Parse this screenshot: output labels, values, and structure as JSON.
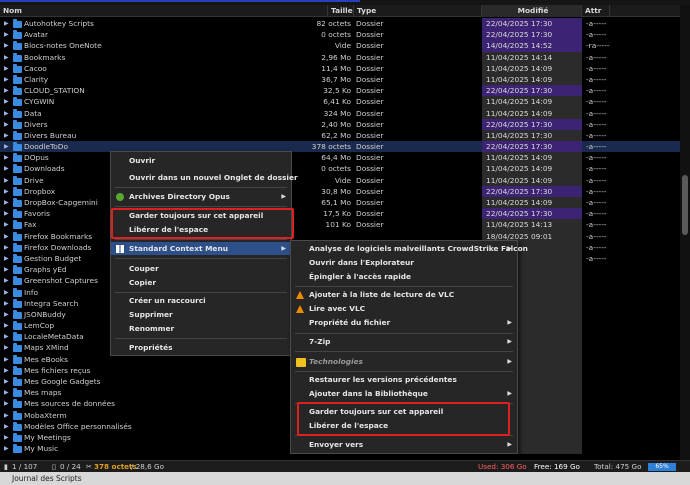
{
  "header": {
    "name": "Nom",
    "size": "Taille",
    "type": "Type",
    "modified": "Modifié",
    "attr": "Attr"
  },
  "rows": [
    {
      "name": "Autohotkey Scripts",
      "size": "82 octets",
      "type": "Dossier",
      "modified": "22/04/2025 17:30",
      "attr": "-a-----",
      "recent": true
    },
    {
      "name": "Avatar",
      "size": "0 octets",
      "type": "Dossier",
      "modified": "22/04/2025 17:30",
      "attr": "-a-----",
      "recent": true
    },
    {
      "name": "Blocs-notes OneNote",
      "size": "Vide",
      "type": "Dossier",
      "modified": "14/04/2025 14:52",
      "attr": "-ra-----",
      "recent": true
    },
    {
      "name": "Bookmarks",
      "size": "2,96 Mo",
      "type": "Dossier",
      "modified": "11/04/2025 14:14",
      "attr": "-a-----",
      "recent": false
    },
    {
      "name": "Cacoo",
      "size": "11,4 Mo",
      "type": "Dossier",
      "modified": "11/04/2025 14:09",
      "attr": "-a-----",
      "recent": false
    },
    {
      "name": "Clarity",
      "size": "36,7 Mo",
      "type": "Dossier",
      "modified": "11/04/2025 14:09",
      "attr": "-a-----",
      "recent": false
    },
    {
      "name": "CLOUD_STATION",
      "size": "32,5 Ko",
      "type": "Dossier",
      "modified": "22/04/2025 17:30",
      "attr": "-a-----",
      "recent": true
    },
    {
      "name": "CYGWIN",
      "size": "6,41 Ko",
      "type": "Dossier",
      "modified": "11/04/2025 14:09",
      "attr": "-a-----",
      "recent": false
    },
    {
      "name": "Data",
      "size": "324 Mo",
      "type": "Dossier",
      "modified": "11/04/2025 14:09",
      "attr": "-a-----",
      "recent": false
    },
    {
      "name": "Divers",
      "size": "2,40 Mo",
      "type": "Dossier",
      "modified": "22/04/2025 17:30",
      "attr": "-a-----",
      "recent": true
    },
    {
      "name": "Divers Bureau",
      "size": "62,2 Mo",
      "type": "Dossier",
      "modified": "11/04/2025 17:30",
      "attr": "-a-----",
      "recent": false
    },
    {
      "name": "DoodleToDo",
      "size": "378 octets",
      "type": "Dossier",
      "modified": "22/04/2025 17:30",
      "attr": "-a-----",
      "recent": true,
      "selected": true
    },
    {
      "name": "DOpus",
      "size": "64,4 Mo",
      "type": "Dossier",
      "modified": "11/04/2025 14:09",
      "attr": "-a-----",
      "recent": false
    },
    {
      "name": "Downloads",
      "size": "0 octets",
      "type": "Dossier",
      "modified": "11/04/2025 14:09",
      "attr": "-a-----",
      "recent": false
    },
    {
      "name": "Drive",
      "size": "Vide",
      "type": "Dossier",
      "modified": "11/04/2025 14:09",
      "attr": "-a-----",
      "recent": false
    },
    {
      "name": "Dropbox",
      "size": "30,8 Mo",
      "type": "Dossier",
      "modified": "22/04/2025 17:30",
      "attr": "-a-----",
      "recent": true
    },
    {
      "name": "DropBox-Capgemini",
      "size": "65,1 Mo",
      "type": "Dossier",
      "modified": "11/04/2025 14:09",
      "attr": "-a-----",
      "recent": false
    },
    {
      "name": "Favoris",
      "size": "17,5 Ko",
      "type": "Dossier",
      "modified": "22/04/2025 17:30",
      "attr": "-a-----",
      "recent": true
    },
    {
      "name": "Fax",
      "size": "101 Ko",
      "type": "Dossier",
      "modified": "11/04/2025 14:13",
      "attr": "-a-----",
      "recent": false
    },
    {
      "name": "Firefox Bookmarks",
      "size": "",
      "type": "",
      "modified": "18/04/2025 09:01",
      "attr": "-a-----",
      "recent": false
    },
    {
      "name": "Firefox Downloads",
      "size": "",
      "type": "",
      "modified": "",
      "attr": "-a-----",
      "recent": true
    },
    {
      "name": "Gestion Budget",
      "size": "",
      "type": "",
      "modified": "",
      "attr": "-a-----",
      "recent": true
    },
    {
      "name": "Graphs yEd",
      "size": "",
      "type": "",
      "modified": "",
      "attr": "",
      "recent": false
    },
    {
      "name": "Greenshot Captures",
      "size": "",
      "type": "",
      "modified": "",
      "attr": "",
      "recent": false
    },
    {
      "name": "Info",
      "size": "",
      "type": "",
      "modified": "",
      "attr": "",
      "recent": false
    },
    {
      "name": "Integra Search",
      "size": "",
      "type": "",
      "modified": "",
      "attr": "",
      "recent": false
    },
    {
      "name": "JSONBuddy",
      "size": "",
      "type": "",
      "modified": "",
      "attr": "",
      "recent": false
    },
    {
      "name": "LemCop",
      "size": "",
      "type": "",
      "modified": "",
      "attr": "",
      "recent": false
    },
    {
      "name": "LocaleMetaData",
      "size": "",
      "type": "",
      "modified": "",
      "attr": "",
      "recent": false
    },
    {
      "name": "Maps XMind",
      "size": "",
      "type": "",
      "modified": "",
      "attr": "",
      "recent": false
    },
    {
      "name": "Mes eBooks",
      "size": "",
      "type": "",
      "modified": "",
      "attr": "",
      "recent": false
    },
    {
      "name": "Mes fichiers reçus",
      "size": "",
      "type": "",
      "modified": "",
      "attr": "",
      "recent": false
    },
    {
      "name": "Mes Google Gadgets",
      "size": "",
      "type": "",
      "modified": "",
      "attr": "",
      "recent": false
    },
    {
      "name": "Mes maps",
      "size": "",
      "type": "",
      "modified": "",
      "attr": "",
      "recent": false
    },
    {
      "name": "Mes sources de données",
      "size": "",
      "type": "",
      "modified": "",
      "attr": "",
      "recent": false
    },
    {
      "name": "MobaXterm",
      "size": "",
      "type": "",
      "modified": "",
      "attr": "",
      "recent": false
    },
    {
      "name": "Modèles Office personnalisés",
      "size": "",
      "type": "",
      "modified": "",
      "attr": "",
      "recent": false
    },
    {
      "name": "My Meetings",
      "size": "",
      "type": "",
      "modified": "",
      "attr": "",
      "recent": false
    },
    {
      "name": "My Music",
      "size": "",
      "type": "",
      "modified": "",
      "attr": "",
      "recent": false
    }
  ],
  "context_menu": {
    "open": "Ouvrir",
    "open_new_tab": "Ouvrir dans un nouvel Onglet de dossier",
    "archives": "Archives Directory Opus",
    "keep_on_device": "Garder toujours sur cet appareil",
    "free_space": "Libérer de l'espace",
    "standard_menu": "Standard Context Menu",
    "cut": "Couper",
    "copy": "Copier",
    "create_shortcut": "Créer un raccourci",
    "delete": "Supprimer",
    "rename": "Renommer",
    "properties": "Propriétés"
  },
  "submenu": {
    "crowdstrike": "Analyse de logiciels malveillants CrowdStrike Falcon",
    "open_explorer": "Ouvrir dans l'Explorateur",
    "pin_quick_access": "Épingler à l'accès rapide",
    "vlc_add": "Ajouter à la liste de lecture de VLC",
    "vlc_play": "Lire avec VLC",
    "ownership": "Propriété du fichier",
    "sevenzip": "7-Zip",
    "technologies": "Technologies",
    "restore_versions": "Restaurer les versions précédentes",
    "add_library": "Ajouter dans la Bibliothèque",
    "keep_on_device": "Garder toujours sur cet appareil",
    "free_space": "Libérer de l'espace",
    "send_to": "Envoyer vers"
  },
  "status": {
    "count": "1 / 107",
    "files": "0 / 24",
    "selection": "378 octets",
    "total": "/ 28,6 Go",
    "used": "Used: 306 Go",
    "free": "Free: 169 Go",
    "total_disk": "Total: 475 Go",
    "pct": "65%"
  },
  "bottom": {
    "label": "Journal des Scripts"
  },
  "colors": {
    "folder": "#3b8be0",
    "recent_date_bg": "#3c2373",
    "menu_highlight": "#2d4f8a",
    "red_box": "#e02020"
  }
}
